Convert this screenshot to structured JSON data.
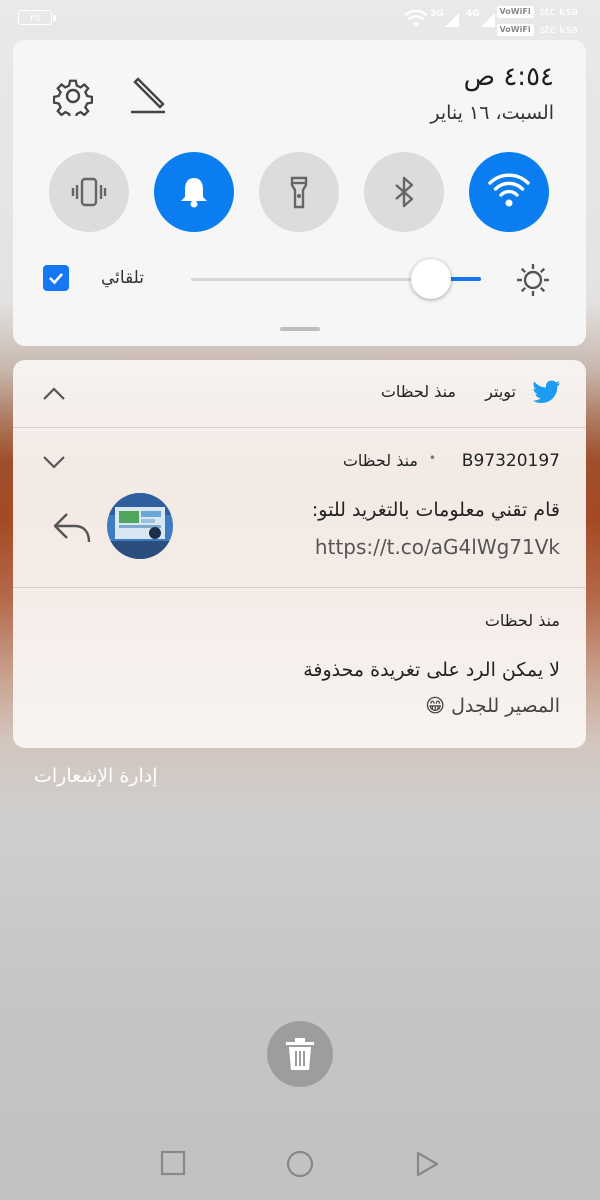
{
  "status_bar": {
    "battery_level": "٢٥",
    "net_left": "3G",
    "net_right": "4G",
    "vowifi_label": "VoWiFi",
    "carriers": [
      "stc ksa",
      "stc ksa"
    ]
  },
  "quick_settings": {
    "time": "٤:٥٤ ص",
    "date": "السبت، ١٦ يناير",
    "toggles": [
      {
        "name": "vibrate",
        "state": "off"
      },
      {
        "name": "sound",
        "state": "on"
      },
      {
        "name": "flashlight",
        "state": "off"
      },
      {
        "name": "bluetooth",
        "state": "off"
      },
      {
        "name": "wifi",
        "state": "on"
      }
    ],
    "auto_brightness_label": "تلقائي",
    "auto_brightness_checked": true,
    "brightness_level": 0.85,
    "accent_color": "#1677f2"
  },
  "notification": {
    "app_name": "تويتر",
    "header_time": "منذ لحظات",
    "item1": {
      "sender": "B97320197",
      "separator": "•",
      "time": "منذ لحظات",
      "text_line1": "قام تقني معلومات بالتغريد للتو:",
      "text_line2": "https://t.co/aG4lWg71Vk"
    },
    "item2": {
      "time": "منذ لحظات",
      "text_line1": "لا يمكن الرد على تغريدة محذوفة",
      "text_line2": "المصير للجدل 😁"
    }
  },
  "manage_notifications": "إدارة الإشعارات"
}
